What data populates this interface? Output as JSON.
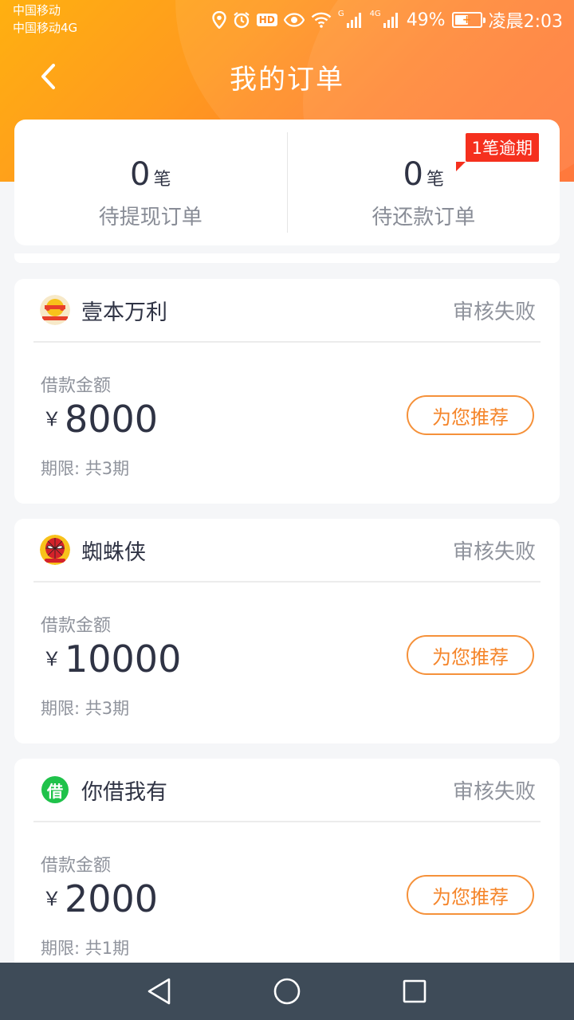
{
  "status_bar": {
    "carrier1": "中国移动",
    "carrier2": "中国移动4G",
    "hd": "HD",
    "sig1_label": "G",
    "sig2_label": "4G",
    "battery": "49%",
    "time": "凌晨2:03"
  },
  "nav": {
    "title": "我的订单"
  },
  "summary": {
    "pending_withdraw": {
      "count": "0",
      "unit": "笔",
      "label": "待提现订单"
    },
    "pending_repay": {
      "count": "0",
      "unit": "笔",
      "label": "待还款订单",
      "badge": "1笔逾期"
    }
  },
  "orders": [
    {
      "brand": "壹本万利",
      "status": "审核失败",
      "amount_label": "借款金额",
      "currency": "￥",
      "amount": "8000",
      "term": "期限: 共3期",
      "button": "为您推荐",
      "logo_icon": "yiben-logo-icon"
    },
    {
      "brand": "蜘蛛侠",
      "status": "审核失败",
      "amount_label": "借款金额",
      "currency": "￥",
      "amount": "10000",
      "term": "期限: 共3期",
      "button": "为您推荐",
      "logo_icon": "spiderman-logo-icon"
    },
    {
      "brand": "你借我有",
      "status": "审核失败",
      "amount_label": "借款金额",
      "currency": "￥",
      "amount": "2000",
      "term": "期限: 共1期",
      "button": "为您推荐",
      "logo_icon": "jie-logo-icon",
      "logo_text": "借"
    }
  ],
  "colors": {
    "header_start": "#ffb010",
    "header_end": "#ff6e2e",
    "accent": "#f5852a",
    "overdue": "#f5301e",
    "nav_bar": "#3e4b58"
  }
}
